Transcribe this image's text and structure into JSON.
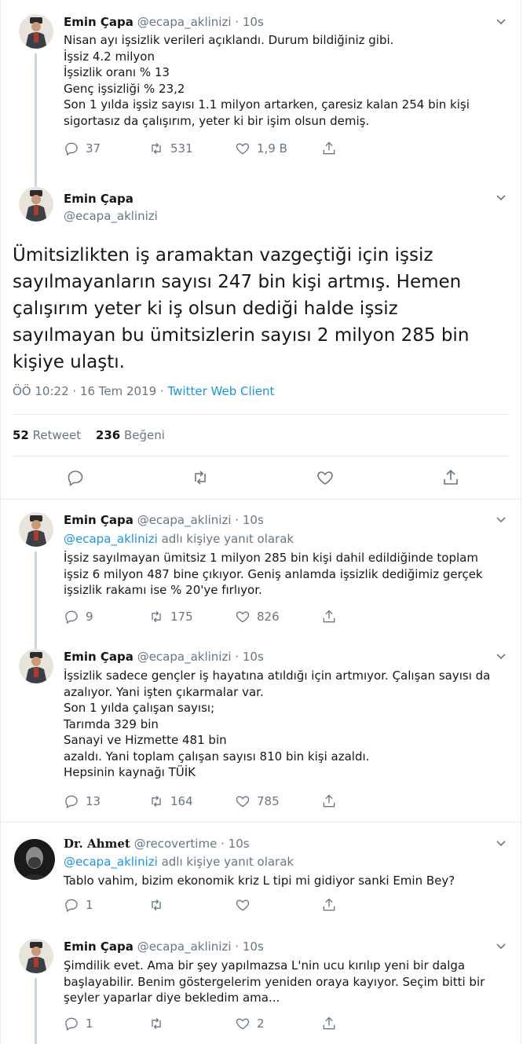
{
  "tweet1": {
    "name": "Emin Çapa",
    "handle": "@ecapa_aklinizi",
    "time": "10s",
    "text": "Nisan ayı işsizlik verileri açıklandı. Durum bildiğiniz gibi.\nİşsiz 4.2 milyon\nİşsizlik oranı % 13\nGenç işsizliği % 23,2\nSon 1 yılda işsiz sayısı 1.1 milyon artarken, çaresiz kalan 254 bin kişi sigortasız da çalışırım, yeter ki bir işim olsun demiş.",
    "replies": "37",
    "retweets": "531",
    "likes": "1,9 B"
  },
  "main": {
    "name": "Emin Çapa",
    "handle": "@ecapa_aklinizi",
    "text": "Ümitsizlikten iş aramaktan vazgeçtiği için işsiz sayılmayanların sayısı 247 bin kişi artmış. Hemen çalışırım yeter ki iş olsun dediği halde işsiz sayılmayan bu ümitsizlerin sayısı 2 milyon 285 bin kişiye ulaştı.",
    "timestamp": "ÖÖ 10:22 · 16 Tem 2019 · ",
    "client": "Twitter Web Client",
    "retweet_count": "52",
    "retweet_label": "Retweet",
    "like_count": "236",
    "like_label": "Beğeni"
  },
  "tweet3": {
    "name": "Emin Çapa",
    "handle": "@ecapa_aklinizi",
    "time": "10s",
    "reply_to_user": "@ecapa_aklinizi",
    "reply_to_suffix": "adlı kişiye yanıt olarak",
    "text": "İşsiz sayılmayan ümitsiz 1 milyon 285 bin kişi dahil edildiğinde toplam işsiz 6 milyon 487 bine çıkıyor. Geniş anlamda işsizlik dediğimiz gerçek işsizlik rakamı ise % 20'ye fırlıyor.",
    "replies": "9",
    "retweets": "175",
    "likes": "826"
  },
  "tweet4": {
    "name": "Emin Çapa",
    "handle": "@ecapa_aklinizi",
    "time": "10s",
    "text": "İşsizlik sadece gençler iş hayatına atıldığı için artmıyor. Çalışan sayısı da azalıyor. Yani işten çıkarmalar var.\nSon 1 yılda çalışan sayısı;\nTarımda 329 bin\nSanayi ve Hizmette 481 bin\nazaldı. Yani toplam çalışan sayısı 810 bin kişi azaldı.\nHepsinin kaynağı TÜİK",
    "replies": "13",
    "retweets": "164",
    "likes": "785"
  },
  "tweet5": {
    "name": "Dr. Ahmet",
    "handle": "@recovertime",
    "time": "10s",
    "reply_to_user": "@ecapa_aklinizi",
    "reply_to_suffix": "adlı kişiye yanıt olarak",
    "text": "Tablo vahim, bizim ekonomik kriz L tipi mi gidiyor sanki Emin Bey?",
    "replies": "1",
    "retweets": "",
    "likes": ""
  },
  "tweet6": {
    "name": "Emin Çapa",
    "handle": "@ecapa_aklinizi",
    "time": "10s",
    "text": "Şimdilik evet. Ama bir şey yapılmazsa L'nin ucu kırılıp yeni bir dalga başlayabilir. Benim göstergelerim yeniden oraya kayıyor. Seçim bitti bir şeyler yaparlar diye bekledim ama...",
    "replies": "1",
    "retweets": "",
    "likes": "2"
  },
  "colors": {
    "accent": "#1b95e0",
    "secondary_text": "#657786",
    "divider": "#e6ecf0",
    "thread_line": "#ccd6dd"
  },
  "icons": [
    "reply-icon",
    "retweet-icon",
    "like-icon",
    "share-icon",
    "caret-down-icon"
  ]
}
